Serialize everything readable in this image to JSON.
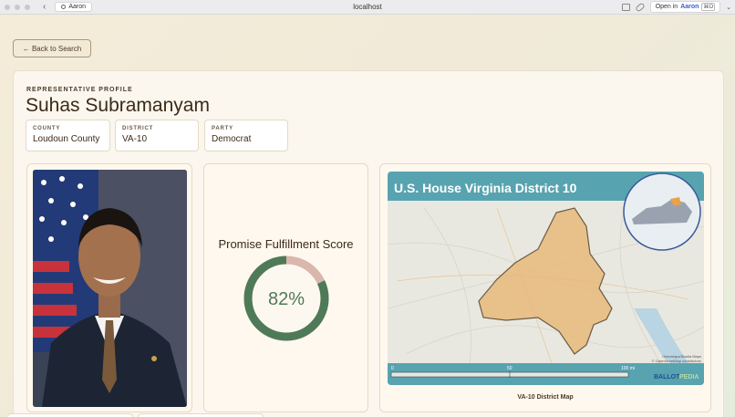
{
  "browser": {
    "tab_label": "Aaron",
    "url": "localhost",
    "open_in_prefix": "Open in",
    "open_in_brand": "Aaron",
    "open_in_shortcut": "⌘O"
  },
  "back_button": {
    "label": "← Back to Search"
  },
  "profile": {
    "eyebrow": "REPRESENTATIVE PROFILE",
    "name": "Suhas Subramanyam",
    "chips": [
      {
        "label": "COUNTY",
        "value": "Loudoun County"
      },
      {
        "label": "DISTRICT",
        "value": "VA-10"
      },
      {
        "label": "PARTY",
        "value": "Democrat"
      }
    ]
  },
  "score": {
    "title": "Promise Fulfillment Score",
    "value_text": "82%",
    "fraction": 0.82,
    "color_fill": "#4f7a58",
    "color_rest": "#d9b7ad"
  },
  "map": {
    "title": "U.S. House Virginia District 10",
    "caption": "VA-10 District Map",
    "scale_marks": [
      "0",
      "50",
      "100 mi"
    ],
    "credit_brand_a": "BALLOT",
    "credit_brand_b": "PEDIA",
    "attribution": "Openmaps/Stadia Maps\n© OpenStreetMap contributors"
  },
  "colors": {
    "accent_brown": "#3b2a18",
    "map_header": "#58a3b0",
    "district_fill": "#e8b87a"
  }
}
